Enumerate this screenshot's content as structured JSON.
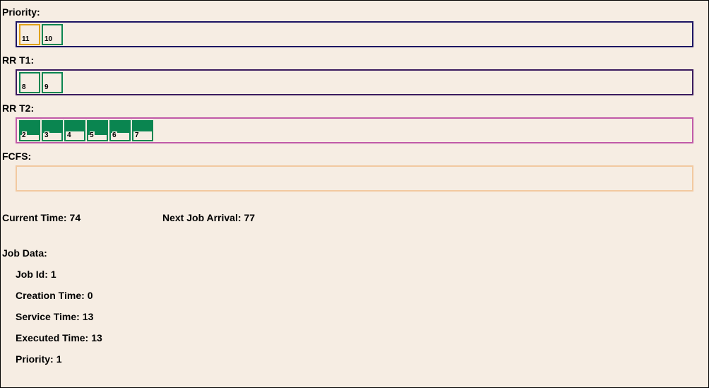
{
  "queues": [
    {
      "label": "Priority:",
      "border_color": "#1c1463",
      "jobs": [
        {
          "id": "11",
          "progress": 0,
          "color": "#e0a21a"
        },
        {
          "id": "10",
          "progress": 0,
          "color": "#0a8550"
        }
      ]
    },
    {
      "label": "RR T1:",
      "border_color": "#3a1a5e",
      "jobs": [
        {
          "id": "8",
          "progress": 0,
          "color": "#0a8550"
        },
        {
          "id": "9",
          "progress": 0,
          "color": "#0a8550"
        }
      ]
    },
    {
      "label": "RR T2:",
      "border_color": "#c05aa8",
      "jobs": [
        {
          "id": "2",
          "progress": 0.72,
          "color": "#0a8550"
        },
        {
          "id": "3",
          "progress": 0.62,
          "color": "#0a8550"
        },
        {
          "id": "4",
          "progress": 0.55,
          "color": "#0a8550"
        },
        {
          "id": "5",
          "progress": 0.72,
          "color": "#0a8550"
        },
        {
          "id": "6",
          "progress": 0.62,
          "color": "#0a8550"
        },
        {
          "id": "7",
          "progress": 0.55,
          "color": "#0a8550"
        }
      ]
    },
    {
      "label": "FCFS:",
      "border_color": "#f2c9a0",
      "jobs": []
    }
  ],
  "status": {
    "current_time_label": "Current Time:",
    "current_time": "74",
    "next_arrival_label": "Next Job Arrival:",
    "next_arrival": "77"
  },
  "job_data": {
    "title": "Job Data:",
    "fields": [
      {
        "label": "Job Id:",
        "value": "1"
      },
      {
        "label": "Creation Time:",
        "value": "0"
      },
      {
        "label": "Service Time:",
        "value": "13"
      },
      {
        "label": "Executed Time:",
        "value": "13"
      },
      {
        "label": "Priority:",
        "value": "1"
      }
    ]
  }
}
